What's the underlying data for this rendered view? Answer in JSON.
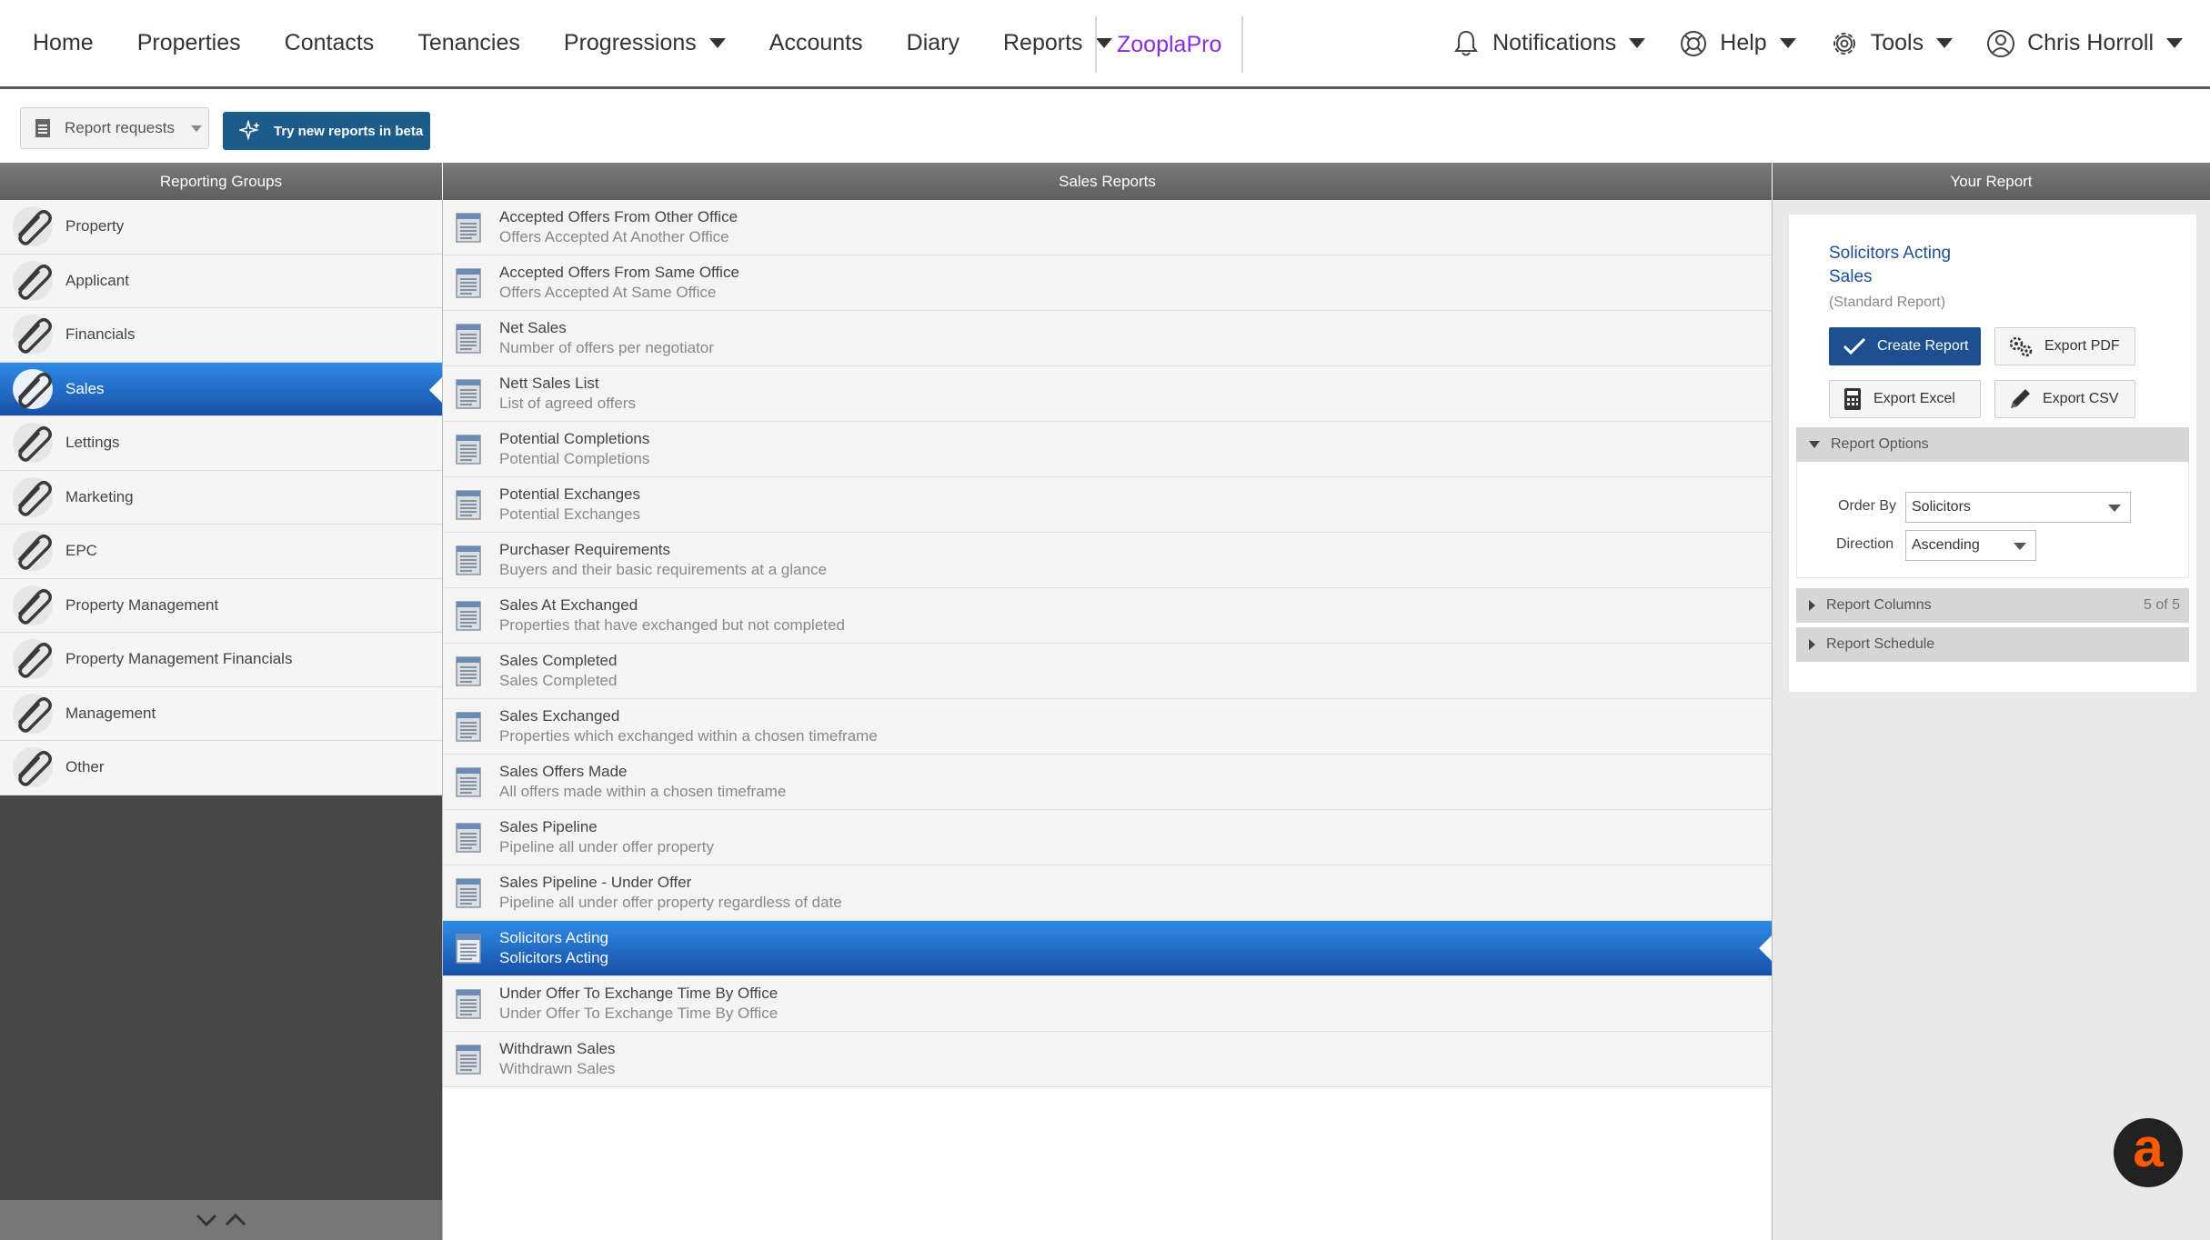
{
  "nav": {
    "left": [
      {
        "label": "Home",
        "dropdown": false
      },
      {
        "label": "Properties",
        "dropdown": false
      },
      {
        "label": "Contacts",
        "dropdown": false
      },
      {
        "label": "Tenancies",
        "dropdown": false
      },
      {
        "label": "Progressions",
        "dropdown": true
      },
      {
        "label": "Accounts",
        "dropdown": false
      },
      {
        "label": "Diary",
        "dropdown": false
      },
      {
        "label": "Reports",
        "dropdown": true
      }
    ],
    "zoopla": "ZooplaPro",
    "notifications": "Notifications",
    "help": "Help",
    "tools": "Tools",
    "user": "Chris Horroll"
  },
  "toolbar": {
    "requests": "Report requests",
    "beta": "Try new reports in beta"
  },
  "headers": {
    "groups": "Reporting Groups",
    "reports": "Sales Reports",
    "yours": "Your Report"
  },
  "groups": [
    {
      "label": "Property",
      "active": false
    },
    {
      "label": "Applicant",
      "active": false
    },
    {
      "label": "Financials",
      "active": false
    },
    {
      "label": "Sales",
      "active": true
    },
    {
      "label": "Lettings",
      "active": false
    },
    {
      "label": "Marketing",
      "active": false
    },
    {
      "label": "EPC",
      "active": false
    },
    {
      "label": "Property Management",
      "active": false
    },
    {
      "label": "Property Management Financials",
      "active": false
    },
    {
      "label": "Management",
      "active": false
    },
    {
      "label": "Other",
      "active": false
    }
  ],
  "reports": [
    {
      "title": "Accepted Offers From Other Office",
      "desc": "Offers Accepted At Another Office",
      "active": false
    },
    {
      "title": "Accepted Offers From Same Office",
      "desc": "Offers Accepted At Same Office",
      "active": false
    },
    {
      "title": "Net Sales",
      "desc": "Number of offers per negotiator",
      "active": false
    },
    {
      "title": "Nett Sales List",
      "desc": "List of agreed offers",
      "active": false
    },
    {
      "title": "Potential Completions",
      "desc": "Potential Completions",
      "active": false
    },
    {
      "title": "Potential Exchanges",
      "desc": "Potential Exchanges",
      "active": false
    },
    {
      "title": "Purchaser Requirements",
      "desc": "Buyers and their basic requirements at a glance",
      "active": false
    },
    {
      "title": "Sales At Exchanged",
      "desc": "Properties that have exchanged but not completed",
      "active": false
    },
    {
      "title": "Sales Completed",
      "desc": "Sales Completed",
      "active": false
    },
    {
      "title": "Sales Exchanged",
      "desc": "Properties which exchanged within a chosen timeframe",
      "active": false
    },
    {
      "title": "Sales Offers Made",
      "desc": "All offers made within a chosen timeframe",
      "active": false
    },
    {
      "title": "Sales Pipeline",
      "desc": "Pipeline all under offer property",
      "active": false
    },
    {
      "title": "Sales Pipeline - Under Offer",
      "desc": "Pipeline all under offer property regardless of date",
      "active": false
    },
    {
      "title": "Solicitors Acting",
      "desc": "Solicitors Acting",
      "active": true
    },
    {
      "title": "Under Offer To Exchange Time By Office",
      "desc": "Under Offer To Exchange Time By Office",
      "active": false
    },
    {
      "title": "Withdrawn Sales",
      "desc": "Withdrawn Sales",
      "active": false
    }
  ],
  "your_report": {
    "title_line1": "Solicitors Acting",
    "title_line2": "Sales",
    "subtitle": "(Standard Report)",
    "create": "Create Report",
    "export_pdf": "Export PDF",
    "export_excel": "Export Excel",
    "export_csv": "Export CSV",
    "options_label": "Report Options",
    "order_by_label": "Order By",
    "order_by_value": "Solicitors",
    "direction_label": "Direction",
    "direction_value": "Ascending",
    "columns_label": "Report Columns",
    "columns_count": "5 of 5",
    "schedule_label": "Report Schedule"
  },
  "brand_letter": "a",
  "colors": {
    "active_gradient_top": "#2f8be6",
    "active_gradient_bottom": "#1750a8",
    "primary_button": "#1d4f91",
    "beta_button": "#1d5b8a",
    "zoopla": "#8a2be2"
  }
}
